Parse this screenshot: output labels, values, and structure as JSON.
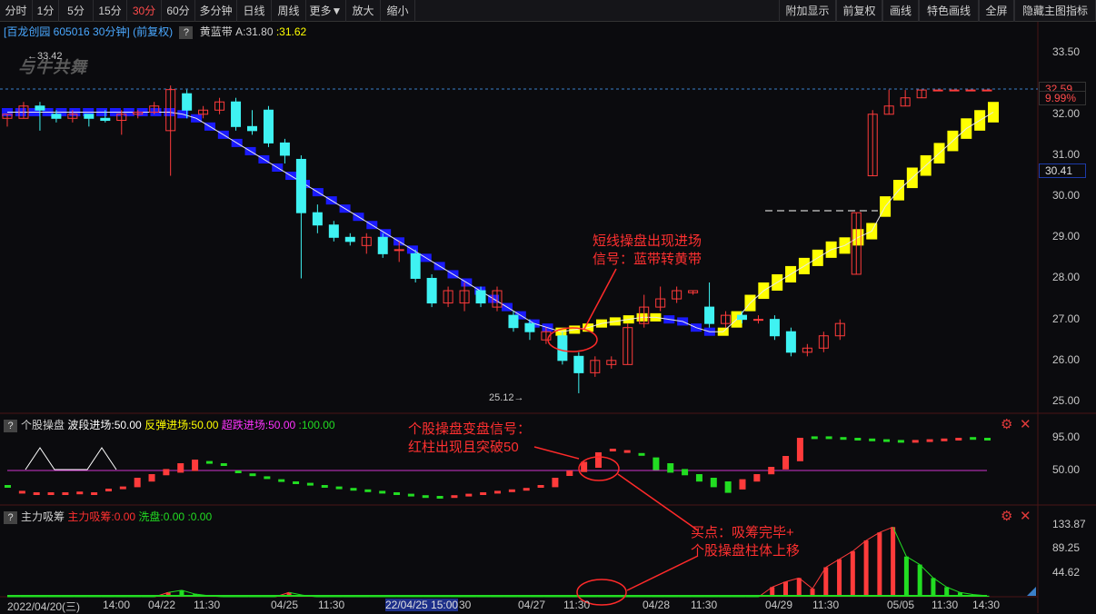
{
  "toolbar": {
    "left": [
      "分时",
      "1分",
      "5分",
      "15分",
      "30分",
      "60分",
      "多分钟",
      "日线",
      "周线",
      "更多▼",
      "放大",
      "缩小"
    ],
    "right": [
      "附加显示",
      "前复权",
      "画线",
      "特色画线",
      "全屏",
      "隐藏主图指标"
    ],
    "active": "30分"
  },
  "stock": {
    "name": "[百龙创园 605016 30分钟]",
    "adjust": "(前复权)",
    "indicator_name": "黄蓝带",
    "a_label": "A:31.80",
    "b_label": ":31.62"
  },
  "logo": "与牛共舞",
  "main_axis": {
    "ticks": [
      "33.50",
      "32.00",
      "31.00",
      "30.00",
      "29.00",
      "28.00",
      "27.00",
      "26.00",
      "25.00"
    ],
    "tags": [
      "32.59",
      "9.99%",
      "30.41"
    ],
    "high": "33.42",
    "low": "25.12"
  },
  "p2": {
    "q": "?",
    "name": "个股操盘",
    "l1": "波段进场:50.00",
    "l2": "反弹进场:50.00",
    "l3": "超跌进场:50.00",
    "l4": ":100.00",
    "ticks": [
      "95.00",
      "50.00"
    ]
  },
  "p3": {
    "q": "?",
    "name": "主力吸筹",
    "l1": "主力吸筹:0.00",
    "l2": "洗盘:0.00",
    "l3": ":0.00",
    "ticks": [
      "133.87",
      "89.25",
      "44.62"
    ]
  },
  "annotations": {
    "a1": "短线操盘出现进场",
    "a2": "信号：蓝带转黄带",
    "b1": "个股操盘变盘信号：",
    "b2": "红柱出现且突破50",
    "c1": "买点：吸筹完毕+",
    "c2": "个股操盘柱体上移"
  },
  "xaxis": [
    "2022/04/20(三)",
    "14:00",
    "04/22",
    "11:30",
    "04/25",
    "11:30",
    "22/04/25 15:00",
    "30",
    "04/27",
    "11:30",
    "04/28",
    "11:30",
    "04/29",
    "11:30",
    "05/05",
    "11:30",
    "14:30"
  ],
  "colors": {
    "up": "#ff3b3b",
    "down": "#3ff2f2",
    "blue": "#1a1aff",
    "yellow": "#ffff00",
    "magenta": "#cc33cc",
    "green": "#22dd22"
  },
  "chart_data": [
    {
      "type": "candlestick",
      "title": "[百龙创园 605016 30分钟]",
      "y_range": [
        25.0,
        33.5
      ],
      "candles": [
        [
          31.9,
          32.0,
          31.7,
          32.0
        ],
        [
          31.9,
          32.2,
          31.9,
          32.3
        ],
        [
          32.2,
          32.1,
          31.6,
          32.3
        ],
        [
          32.0,
          31.9,
          31.8,
          32.1
        ],
        [
          31.9,
          32.0,
          31.8,
          32.1
        ],
        [
          32.0,
          31.9,
          31.7,
          32.0
        ],
        [
          31.9,
          31.85,
          31.8,
          32.1
        ],
        [
          31.85,
          32.0,
          31.5,
          32.1
        ],
        [
          32.0,
          32.05,
          31.9,
          32.1
        ],
        [
          32.05,
          32.2,
          32.0,
          32.3
        ],
        [
          31.6,
          32.6,
          30.5,
          32.7
        ],
        [
          32.5,
          32.1,
          31.9,
          32.6
        ],
        [
          32.0,
          32.1,
          31.9,
          32.2
        ],
        [
          32.1,
          32.3,
          32.0,
          32.4
        ],
        [
          32.3,
          31.7,
          31.6,
          32.4
        ],
        [
          31.7,
          31.6,
          31.5,
          32.1
        ],
        [
          32.1,
          31.3,
          31.2,
          32.2
        ],
        [
          31.3,
          31.0,
          30.8,
          31.4
        ],
        [
          30.9,
          29.6,
          28.0,
          31.0
        ],
        [
          29.6,
          29.3,
          29.1,
          29.8
        ],
        [
          29.3,
          29.0,
          28.9,
          29.4
        ],
        [
          29.0,
          28.9,
          28.8,
          29.1
        ],
        [
          28.8,
          29.0,
          28.6,
          29.1
        ],
        [
          29.0,
          28.6,
          28.5,
          29.1
        ],
        [
          28.7,
          28.7,
          28.4,
          28.9
        ],
        [
          28.6,
          28.0,
          27.9,
          28.7
        ],
        [
          28.0,
          27.4,
          27.3,
          28.1
        ],
        [
          27.4,
          27.7,
          27.3,
          27.8
        ],
        [
          27.4,
          27.7,
          27.2,
          27.9
        ],
        [
          27.7,
          27.4,
          27.3,
          27.8
        ],
        [
          27.3,
          27.7,
          27.2,
          27.8
        ],
        [
          27.1,
          26.8,
          26.7,
          27.2
        ],
        [
          26.9,
          26.7,
          26.5,
          27.0
        ],
        [
          26.5,
          26.7,
          26.4,
          26.8
        ],
        [
          26.6,
          26.0,
          25.9,
          26.7
        ],
        [
          26.1,
          25.7,
          25.2,
          26.2
        ],
        [
          25.7,
          26.0,
          25.6,
          26.1
        ],
        [
          25.9,
          26.0,
          25.8,
          26.1
        ],
        [
          25.9,
          26.8,
          25.9,
          26.9
        ],
        [
          26.9,
          27.3,
          26.8,
          27.6
        ],
        [
          27.3,
          27.5,
          27.2,
          27.8
        ],
        [
          27.5,
          27.7,
          27.4,
          27.8
        ],
        [
          27.65,
          27.7,
          27.6,
          27.7
        ],
        [
          27.3,
          26.9,
          26.8,
          27.9
        ],
        [
          26.9,
          27.1,
          26.8,
          27.2
        ],
        [
          27.1,
          27.0,
          26.9,
          27.2
        ],
        [
          27.0,
          27.0,
          26.9,
          27.1
        ],
        [
          27.0,
          26.6,
          26.5,
          27.1
        ],
        [
          26.7,
          26.2,
          26.1,
          26.8
        ],
        [
          26.2,
          26.3,
          26.1,
          26.4
        ],
        [
          26.3,
          26.6,
          26.2,
          26.7
        ],
        [
          26.6,
          26.9,
          26.5,
          27.0
        ],
        [
          28.1,
          29.6,
          28.1,
          29.6
        ],
        [
          30.5,
          32.0,
          30.5,
          32.1
        ],
        [
          32.0,
          32.2,
          32.0,
          32.6
        ],
        [
          32.2,
          32.4,
          32.2,
          32.59
        ],
        [
          32.4,
          32.59,
          32.4,
          32.59
        ],
        [
          32.59,
          32.59,
          32.59,
          32.59
        ],
        [
          32.59,
          32.59,
          32.59,
          32.59
        ],
        [
          32.59,
          32.59,
          32.59,
          32.59
        ],
        [
          32.59,
          32.59,
          32.59,
          32.59
        ]
      ],
      "band": [
        [
          31.95,
          32.15
        ],
        [
          31.95,
          32.15
        ],
        [
          31.95,
          32.15
        ],
        [
          31.95,
          32.15
        ],
        [
          31.95,
          32.15
        ],
        [
          31.95,
          32.15
        ],
        [
          31.95,
          32.15
        ],
        [
          31.95,
          32.15
        ],
        [
          31.95,
          32.15
        ],
        [
          31.95,
          32.15
        ],
        [
          31.95,
          32.15
        ],
        [
          31.95,
          32.15
        ],
        [
          31.95,
          32.15
        ],
        [
          31.9,
          32.1
        ],
        [
          31.8,
          32.0
        ],
        [
          31.6,
          31.8
        ],
        [
          31.4,
          31.6
        ],
        [
          31.2,
          31.4
        ],
        [
          31.0,
          31.2
        ],
        [
          30.8,
          31.0
        ],
        [
          30.6,
          30.8
        ],
        [
          30.4,
          30.6
        ],
        [
          30.2,
          30.4
        ],
        [
          30.0,
          30.2
        ],
        [
          29.8,
          30.0
        ],
        [
          29.6,
          29.8
        ],
        [
          29.4,
          29.6
        ],
        [
          29.2,
          29.4
        ],
        [
          29.0,
          29.2
        ],
        [
          28.8,
          29.0
        ],
        [
          28.6,
          28.8
        ],
        [
          28.4,
          28.6
        ],
        [
          28.2,
          28.4
        ],
        [
          28.0,
          28.2
        ],
        [
          27.8,
          28.0
        ],
        [
          27.6,
          27.8
        ],
        [
          27.4,
          27.6
        ],
        [
          27.2,
          27.4
        ],
        [
          27.0,
          27.2
        ],
        [
          26.8,
          27.0
        ],
        [
          26.7,
          26.9
        ],
        [
          26.6,
          26.8
        ],
        [
          26.65,
          26.85
        ],
        [
          26.7,
          26.9
        ],
        [
          26.8,
          27.0
        ],
        [
          26.85,
          27.05
        ],
        [
          26.9,
          27.1
        ],
        [
          26.95,
          27.15
        ],
        [
          26.95,
          27.15
        ],
        [
          26.9,
          27.1
        ],
        [
          26.85,
          27.05
        ],
        [
          26.7,
          26.9
        ],
        [
          26.6,
          26.8
        ],
        [
          26.6,
          26.8
        ],
        [
          26.8,
          27.2
        ],
        [
          27.2,
          27.6
        ],
        [
          27.5,
          27.9
        ],
        [
          27.7,
          28.1
        ],
        [
          27.9,
          28.3
        ],
        [
          28.1,
          28.5
        ],
        [
          28.3,
          28.7
        ],
        [
          28.5,
          28.9
        ],
        [
          28.6,
          29.0
        ],
        [
          28.8,
          29.2
        ],
        [
          28.95,
          29.35
        ],
        [
          29.5,
          30.0
        ],
        [
          29.9,
          30.4
        ],
        [
          30.2,
          30.7
        ],
        [
          30.5,
          31.0
        ],
        [
          30.8,
          31.3
        ],
        [
          31.1,
          31.6
        ],
        [
          31.4,
          31.9
        ],
        [
          31.6,
          32.1
        ],
        [
          31.8,
          32.3
        ]
      ],
      "band_color": [
        "b",
        "b",
        "b",
        "b",
        "b",
        "b",
        "b",
        "b",
        "b",
        "b",
        "b",
        "b",
        "b",
        "b",
        "b",
        "b",
        "b",
        "b",
        "b",
        "b",
        "b",
        "b",
        "b",
        "b",
        "b",
        "b",
        "b",
        "b",
        "b",
        "b",
        "b",
        "b",
        "b",
        "b",
        "b",
        "b",
        "b",
        "b",
        "b",
        "b",
        "b",
        "y",
        "y",
        "y",
        "y",
        "y",
        "y",
        "y",
        "y",
        "b",
        "b",
        "b",
        "b",
        "y",
        "y",
        "y",
        "y",
        "y",
        "y",
        "y",
        "y",
        "y",
        "y",
        "y",
        "y",
        "y",
        "y",
        "y",
        "y",
        "y",
        "y",
        "y",
        "y",
        "y"
      ]
    },
    {
      "type": "bar",
      "title": "个股操盘",
      "y_ticks": [
        95.0,
        50.0
      ],
      "values": [
        30,
        22,
        20,
        20,
        20,
        21,
        20,
        25,
        28,
        40,
        45,
        52,
        60,
        65,
        63,
        60,
        50,
        46,
        42,
        38,
        35,
        33,
        30,
        28,
        26,
        24,
        22,
        20,
        18,
        16,
        15,
        16,
        18,
        20,
        22,
        24,
        26,
        30,
        40,
        50,
        62,
        75,
        80,
        78,
        74,
        68,
        60,
        52,
        45,
        40,
        35,
        38,
        45,
        55,
        70,
        95,
        97,
        97,
        96,
        95,
        94,
        93,
        92,
        92,
        93,
        94,
        95,
        96,
        95
      ],
      "colors": [
        "g",
        "r",
        "r",
        "r",
        "r",
        "r",
        "r",
        "r",
        "r",
        "r",
        "r",
        "r",
        "r",
        "r",
        "g",
        "g",
        "g",
        "g",
        "g",
        "g",
        "g",
        "g",
        "g",
        "g",
        "g",
        "g",
        "g",
        "g",
        "g",
        "g",
        "g",
        "r",
        "r",
        "r",
        "r",
        "r",
        "r",
        "r",
        "r",
        "r",
        "r",
        "r",
        "r",
        "r",
        "g",
        "g",
        "g",
        "g",
        "g",
        "g",
        "g",
        "r",
        "r",
        "r",
        "r",
        "r",
        "g",
        "g",
        "g",
        "g",
        "g",
        "g",
        "g",
        "r",
        "r",
        "r",
        "r",
        "g",
        "g"
      ]
    },
    {
      "type": "bar",
      "title": "主力吸筹",
      "y_ticks": [
        133.87,
        89.25,
        44.62
      ],
      "values": [
        0,
        0,
        0,
        0,
        0,
        0,
        0,
        0,
        0,
        0,
        0,
        0,
        8,
        12,
        5,
        2,
        0,
        0,
        0,
        0,
        0,
        8,
        3,
        0,
        0,
        0,
        0,
        0,
        0,
        0,
        0,
        0,
        0,
        0,
        0,
        0,
        0,
        0,
        0,
        0,
        0,
        0,
        0,
        0,
        0,
        0,
        0,
        0,
        0,
        0,
        0,
        0,
        0,
        0,
        0,
        0,
        0,
        18,
        28,
        35,
        15,
        55,
        70,
        85,
        105,
        120,
        130,
        75,
        60,
        35,
        18,
        8,
        4,
        2
      ],
      "colors": [
        "g",
        "g",
        "g",
        "g",
        "g",
        "g",
        "g",
        "g",
        "g",
        "g",
        "g",
        "g",
        "r",
        "g",
        "g",
        "g",
        "g",
        "g",
        "g",
        "g",
        "g",
        "r",
        "g",
        "g",
        "g",
        "g",
        "g",
        "g",
        "g",
        "g",
        "g",
        "g",
        "g",
        "g",
        "g",
        "g",
        "g",
        "g",
        "g",
        "g",
        "g",
        "g",
        "g",
        "g",
        "g",
        "g",
        "g",
        "g",
        "g",
        "g",
        "g",
        "g",
        "g",
        "g",
        "g",
        "g",
        "g",
        "r",
        "r",
        "r",
        "r",
        "r",
        "r",
        "r",
        "r",
        "r",
        "r",
        "g",
        "g",
        "g",
        "g",
        "g",
        "g",
        "g"
      ]
    }
  ]
}
